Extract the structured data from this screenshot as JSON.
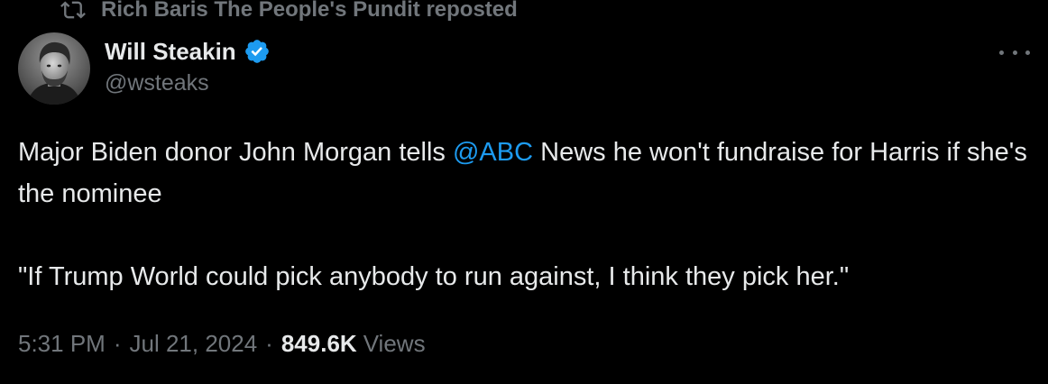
{
  "social_context": {
    "icon": "repost-icon",
    "text": "Rich Baris The People's Pundit reposted"
  },
  "author": {
    "display_name": "Will Steakin",
    "handle": "@wsteaks",
    "verified": true,
    "verified_icon": "verified-badge-icon",
    "avatar": "avatar-photo"
  },
  "more_icon": "more-horizontal-icon",
  "tweet": {
    "line1_before": "Major Biden donor John Morgan tells ",
    "mention": "@ABC",
    "line1_after": " News he won't fundraise for Harris if she's the nominee",
    "quote": "\"If Trump World could pick anybody to run against, I think they pick her.\""
  },
  "meta": {
    "time": "5:31 PM",
    "separator": "·",
    "date": "Jul 21, 2024",
    "views_count": "849.6K",
    "views_label": "Views"
  },
  "colors": {
    "background": "#000000",
    "primary_text": "#e7e9ea",
    "secondary_text": "#71767b",
    "link": "#1d9bf0",
    "verified": "#1d9bf0"
  }
}
